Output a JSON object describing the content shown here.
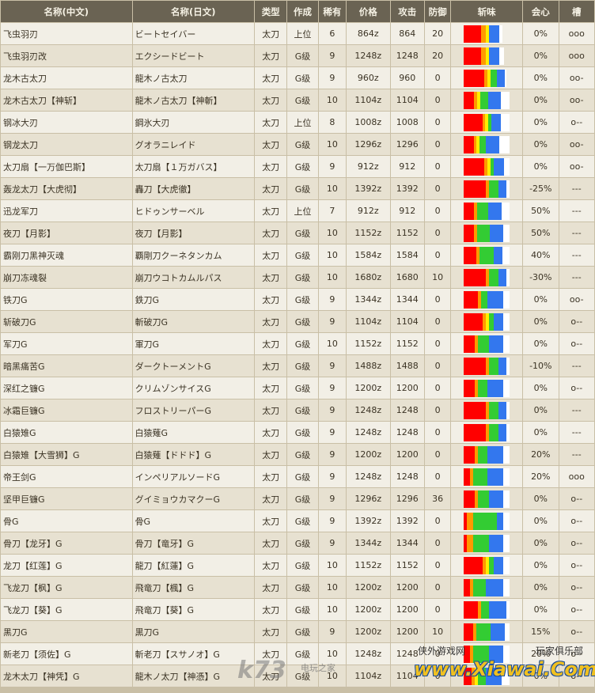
{
  "headers": [
    "名称(中文)",
    "名称(日文)",
    "类型",
    "作成",
    "稀有",
    "价格",
    "攻击",
    "防御",
    "斩味",
    "会心",
    "槽"
  ],
  "colors": {
    "red": "#ff0000",
    "orange": "#ff9900",
    "yellow": "#ffee00",
    "green": "#33cc33",
    "blue": "#3377ee",
    "white": "#ffffff"
  },
  "rows": [
    {
      "cn": "飞虫羽刃",
      "jp": "ビートセイバー",
      "type": "太刀",
      "make": "上位",
      "rare": "6",
      "price": "864z",
      "atk": "864",
      "def": "20",
      "crit": "0%",
      "slot": "ooo",
      "sharp": [
        22,
        6,
        4,
        0,
        13,
        4
      ]
    },
    {
      "cn": "飞虫羽刃改",
      "jp": "エクシードビート",
      "type": "太刀",
      "make": "G级",
      "rare": "9",
      "price": "1248z",
      "atk": "1248",
      "def": "20",
      "crit": "0%",
      "slot": "ooo",
      "sharp": [
        22,
        6,
        4,
        0,
        13,
        6
      ]
    },
    {
      "cn": "龙木古太刀",
      "jp": "龍木ノ古太刀",
      "type": "太刀",
      "make": "G级",
      "rare": "9",
      "price": "960z",
      "atk": "960",
      "def": "0",
      "crit": "0%",
      "slot": "oo-",
      "sharp": [
        26,
        4,
        4,
        8,
        10,
        2
      ]
    },
    {
      "cn": "龙木古太刀【神斩】",
      "jp": "龍木ノ古太刀【神斬】",
      "type": "太刀",
      "make": "G级",
      "rare": "10",
      "price": "1104z",
      "atk": "1104",
      "def": "0",
      "crit": "0%",
      "slot": "oo-",
      "sharp": [
        13,
        4,
        4,
        10,
        16,
        11
      ]
    },
    {
      "cn": "钢冰大刃",
      "jp": "鋼氷大刃",
      "type": "太刀",
      "make": "上位",
      "rare": "8",
      "price": "1008z",
      "atk": "1008",
      "def": "0",
      "crit": "0%",
      "slot": "o--",
      "sharp": [
        24,
        3,
        4,
        4,
        12,
        11
      ]
    },
    {
      "cn": "钢龙太刀",
      "jp": "グオラニレイド",
      "type": "太刀",
      "make": "G级",
      "rare": "10",
      "price": "1296z",
      "atk": "1296",
      "def": "0",
      "crit": "0%",
      "slot": "oo-",
      "sharp": [
        13,
        3,
        4,
        8,
        17,
        13
      ]
    },
    {
      "cn": "太刀扇【一万伽巴斯】",
      "jp": "太刀扇【１万ガバス】",
      "type": "太刀",
      "make": "G级",
      "rare": "9",
      "price": "912z",
      "atk": "912",
      "def": "0",
      "crit": "0%",
      "slot": "oo-",
      "sharp": [
        26,
        4,
        4,
        4,
        13,
        7
      ]
    },
    {
      "cn": "轰龙太刀【大虎彻】",
      "jp": "轟刀【大虎徹】",
      "type": "太刀",
      "make": "G级",
      "rare": "10",
      "price": "1392z",
      "atk": "1392",
      "def": "0",
      "crit": "-25%",
      "slot": "---",
      "sharp": [
        28,
        4,
        0,
        12,
        10,
        4
      ]
    },
    {
      "cn": "迅龙军刀",
      "jp": "ヒドゥンサーベル",
      "type": "太刀",
      "make": "上位",
      "rare": "7",
      "price": "912z",
      "atk": "912",
      "def": "0",
      "crit": "50%",
      "slot": "---",
      "sharp": [
        13,
        4,
        0,
        14,
        17,
        10
      ]
    },
    {
      "cn": "夜刀【月影】",
      "jp": "夜刀【月影】",
      "type": "太刀",
      "make": "G级",
      "rare": "10",
      "price": "1152z",
      "atk": "1152",
      "def": "0",
      "crit": "50%",
      "slot": "---",
      "sharp": [
        13,
        4,
        0,
        16,
        17,
        8
      ]
    },
    {
      "cn": "霸刚刀黑神灭魂",
      "jp": "覇剛刀クーネタンカム",
      "type": "太刀",
      "make": "G级",
      "rare": "10",
      "price": "1584z",
      "atk": "1584",
      "def": "0",
      "crit": "40%",
      "slot": "---",
      "sharp": [
        16,
        4,
        0,
        18,
        11,
        9
      ]
    },
    {
      "cn": "崩刀冻魂裂",
      "jp": "崩刀ウコトカムルパス",
      "type": "太刀",
      "make": "G级",
      "rare": "10",
      "price": "1680z",
      "atk": "1680",
      "def": "10",
      "crit": "-30%",
      "slot": "---",
      "sharp": [
        28,
        4,
        0,
        12,
        10,
        4
      ]
    },
    {
      "cn": "铁刀G",
      "jp": "鉄刀G",
      "type": "太刀",
      "make": "G级",
      "rare": "9",
      "price": "1344z",
      "atk": "1344",
      "def": "0",
      "crit": "0%",
      "slot": "oo-",
      "sharp": [
        18,
        4,
        0,
        8,
        20,
        8
      ]
    },
    {
      "cn": "斩破刀G",
      "jp": "斬破刀G",
      "type": "太刀",
      "make": "G级",
      "rare": "9",
      "price": "1104z",
      "atk": "1104",
      "def": "0",
      "crit": "0%",
      "slot": "o--",
      "sharp": [
        24,
        4,
        4,
        6,
        12,
        8
      ]
    },
    {
      "cn": "军刀G",
      "jp": "軍刀G",
      "type": "太刀",
      "make": "G级",
      "rare": "10",
      "price": "1152z",
      "atk": "1152",
      "def": "0",
      "crit": "0%",
      "slot": "o--",
      "sharp": [
        14,
        4,
        0,
        14,
        18,
        8
      ]
    },
    {
      "cn": "暗黑痛苦G",
      "jp": "ダークトーメントG",
      "type": "太刀",
      "make": "G级",
      "rare": "9",
      "price": "1488z",
      "atk": "1488",
      "def": "0",
      "crit": "-10%",
      "slot": "---",
      "sharp": [
        28,
        4,
        0,
        12,
        10,
        4
      ]
    },
    {
      "cn": "深红之镰G",
      "jp": "クリムゾンサイスG",
      "type": "太刀",
      "make": "G级",
      "rare": "9",
      "price": "1200z",
      "atk": "1200",
      "def": "0",
      "crit": "0%",
      "slot": "o--",
      "sharp": [
        14,
        4,
        0,
        12,
        20,
        8
      ]
    },
    {
      "cn": "冰霜巨镰G",
      "jp": "フロストリーパーG",
      "type": "太刀",
      "make": "G级",
      "rare": "9",
      "price": "1248z",
      "atk": "1248",
      "def": "0",
      "crit": "0%",
      "slot": "---",
      "sharp": [
        28,
        4,
        0,
        12,
        10,
        4
      ]
    },
    {
      "cn": "白猿雉G",
      "jp": "白猿薙G",
      "type": "太刀",
      "make": "G级",
      "rare": "9",
      "price": "1248z",
      "atk": "1248",
      "def": "0",
      "crit": "0%",
      "slot": "---",
      "sharp": [
        28,
        4,
        0,
        12,
        10,
        4
      ]
    },
    {
      "cn": "白猿雉【大雪狮】G",
      "jp": "白猿薙【ドドド】G",
      "type": "太刀",
      "make": "G级",
      "rare": "9",
      "price": "1200z",
      "atk": "1200",
      "def": "0",
      "crit": "20%",
      "slot": "---",
      "sharp": [
        14,
        4,
        0,
        12,
        20,
        8
      ]
    },
    {
      "cn": "帝王剑G",
      "jp": "インペリアルソードG",
      "type": "太刀",
      "make": "G级",
      "rare": "9",
      "price": "1248z",
      "atk": "1248",
      "def": "0",
      "crit": "20%",
      "slot": "ooo",
      "sharp": [
        8,
        4,
        0,
        18,
        20,
        8
      ]
    },
    {
      "cn": "坚甲巨镰G",
      "jp": "グイミョウカマクーG",
      "type": "太刀",
      "make": "G级",
      "rare": "9",
      "price": "1296z",
      "atk": "1296",
      "def": "36",
      "crit": "0%",
      "slot": "o--",
      "sharp": [
        14,
        4,
        0,
        14,
        18,
        8
      ]
    },
    {
      "cn": "骨G",
      "jp": "骨G",
      "type": "太刀",
      "make": "G级",
      "rare": "9",
      "price": "1392z",
      "atk": "1392",
      "def": "0",
      "crit": "0%",
      "slot": "o--",
      "sharp": [
        4,
        8,
        0,
        30,
        8,
        8
      ]
    },
    {
      "cn": "骨刀【龙牙】G",
      "jp": "骨刀【竜牙】G",
      "type": "太刀",
      "make": "G级",
      "rare": "9",
      "price": "1344z",
      "atk": "1344",
      "def": "0",
      "crit": "0%",
      "slot": "o--",
      "sharp": [
        4,
        8,
        0,
        20,
        18,
        8
      ]
    },
    {
      "cn": "龙刀【红莲】G",
      "jp": "龍刀【紅蓮】G",
      "type": "太刀",
      "make": "G级",
      "rare": "10",
      "price": "1152z",
      "atk": "1152",
      "def": "0",
      "crit": "0%",
      "slot": "o--",
      "sharp": [
        24,
        4,
        4,
        6,
        12,
        8
      ]
    },
    {
      "cn": "飞龙刀【枫】G",
      "jp": "飛竜刀【楓】G",
      "type": "太刀",
      "make": "G级",
      "rare": "10",
      "price": "1200z",
      "atk": "1200",
      "def": "0",
      "crit": "0%",
      "slot": "o--",
      "sharp": [
        8,
        4,
        0,
        16,
        22,
        8
      ]
    },
    {
      "cn": "飞龙刀【葵】G",
      "jp": "飛竜刀【葵】G",
      "type": "太刀",
      "make": "G级",
      "rare": "10",
      "price": "1200z",
      "atk": "1200",
      "def": "0",
      "crit": "0%",
      "slot": "o--",
      "sharp": [
        18,
        4,
        0,
        10,
        22,
        4
      ]
    },
    {
      "cn": "黑刀G",
      "jp": "黒刀G",
      "type": "太刀",
      "make": "G级",
      "rare": "9",
      "price": "1200z",
      "atk": "1200",
      "def": "10",
      "crit": "15%",
      "slot": "o--",
      "sharp": [
        12,
        4,
        0,
        18,
        18,
        6
      ]
    },
    {
      "cn": "新老刀【须佐】G",
      "jp": "斬老刀【スサノオ】G",
      "type": "太刀",
      "make": "G级",
      "rare": "10",
      "price": "1248z",
      "atk": "1248",
      "def": "0",
      "crit": "20%",
      "slot": "o--",
      "sharp": [
        8,
        4,
        0,
        20,
        18,
        8
      ]
    },
    {
      "cn": "龙木太刀【神凭】G",
      "jp": "龍木ノ太刀【神憑】G",
      "type": "太刀",
      "make": "G级",
      "rare": "10",
      "price": "1104z",
      "atk": "1104",
      "def": "0",
      "crit": "0%",
      "slot": "o--",
      "sharp": [
        10,
        4,
        4,
        10,
        20,
        10
      ]
    }
  ],
  "watermark": {
    "k73": "k73",
    "k73_sub": "电玩之家",
    "left_text": "侠外游戏网",
    "right_text": "玩家俱乐部",
    "domain": "www.Xiawai.Com"
  }
}
